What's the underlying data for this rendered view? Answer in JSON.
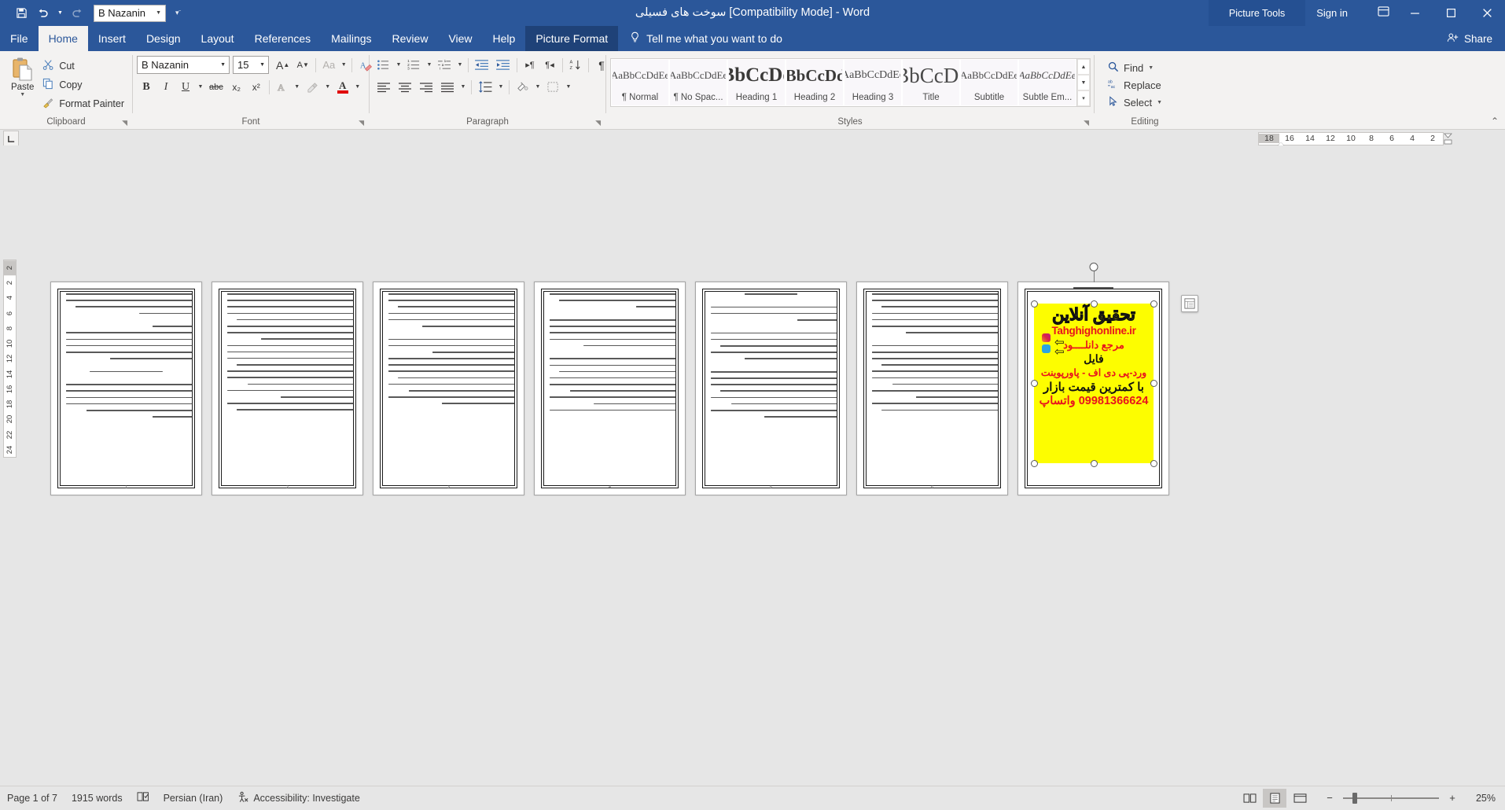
{
  "titlebar": {
    "save_icon": "save-icon",
    "undo_icon": "undo-icon",
    "redo_icon": "redo-icon",
    "font_quick": "B Nazanin",
    "qat_more": "qat-more-icon",
    "doc_title_rtl": "سوخت های فسیلی",
    "doc_title_mode": "[Compatibility Mode]",
    "doc_app": "Word",
    "separator": "-",
    "picture_tools": "Picture Tools",
    "signin": "Sign in",
    "ribbon_display_icon": "ribbon-display-options-icon",
    "minimize": "minimize-icon",
    "restore": "restore-icon",
    "close": "close-icon"
  },
  "tabs": [
    {
      "label": "File",
      "active": false
    },
    {
      "label": "Home",
      "active": true
    },
    {
      "label": "Insert",
      "active": false
    },
    {
      "label": "Design",
      "active": false
    },
    {
      "label": "Layout",
      "active": false
    },
    {
      "label": "References",
      "active": false
    },
    {
      "label": "Mailings",
      "active": false
    },
    {
      "label": "Review",
      "active": false
    },
    {
      "label": "View",
      "active": false
    },
    {
      "label": "Help",
      "active": false
    },
    {
      "label": "Picture Format",
      "active": false
    }
  ],
  "tellme": {
    "icon": "lightbulb-icon",
    "placeholder": "Tell me what you want to do"
  },
  "share": {
    "label": "Share",
    "icon": "share-person-icon"
  },
  "clipboard": {
    "group_label": "Clipboard",
    "paste": "Paste",
    "cut": "Cut",
    "copy": "Copy",
    "format_painter": "Format Painter"
  },
  "font": {
    "group_label": "Font",
    "name": "B Nazanin",
    "size": "15",
    "grow": "A",
    "shrink": "A",
    "change_case": "Aa",
    "clear_formatting": "clear-formatting-icon",
    "bold": "B",
    "italic": "I",
    "underline": "U",
    "strikethrough": "abc",
    "subscript": "x₂",
    "superscript": "x²",
    "text_effects": "A",
    "highlight": "highlight-icon",
    "font_color": "A"
  },
  "paragraph": {
    "group_label": "Paragraph",
    "bullets": "bullets-icon",
    "numbering": "numbering-icon",
    "multilevel": "multilevel-list-icon",
    "decrease_indent": "decrease-indent-icon",
    "increase_indent": "increase-indent-icon",
    "ltr": "left-to-right-icon",
    "rtl": "right-to-left-icon",
    "sort": "sort-icon",
    "show_marks": "show-formatting-marks-icon",
    "align_left": "align-left-icon",
    "align_center": "align-center-icon",
    "align_right": "align-right-icon",
    "justify": "justify-icon",
    "line_spacing": "line-spacing-icon",
    "shading": "shading-icon",
    "borders": "borders-icon"
  },
  "styles": {
    "group_label": "Styles",
    "items": [
      {
        "preview": "AaBbCcDdEe",
        "name": "¶ Normal",
        "size": 13,
        "bold": false,
        "italic": false
      },
      {
        "preview": "AaBbCcDdEe",
        "name": "¶ No Spac...",
        "size": 13,
        "bold": false,
        "italic": false
      },
      {
        "preview": "AaBbCcDdEe",
        "name": "Heading 1",
        "size": 25,
        "bold": true,
        "italic": false
      },
      {
        "preview": "AaBbCcDdEe",
        "name": "Heading 2",
        "size": 21,
        "bold": true,
        "italic": false
      },
      {
        "preview": "AaBbCcDdEe",
        "name": "Heading 3",
        "size": 14,
        "bold": false,
        "italic": false
      },
      {
        "preview": "AaBbCcDdEe",
        "name": "Title",
        "size": 27,
        "bold": false,
        "italic": false
      },
      {
        "preview": "AaBbCcDdEe",
        "name": "Subtitle",
        "size": 13,
        "bold": false,
        "italic": false
      },
      {
        "preview": "AaBbCcDdEe",
        "name": "Subtle Em...",
        "size": 13,
        "bold": false,
        "italic": true
      }
    ]
  },
  "editing": {
    "group_label": "Editing",
    "find": "Find",
    "replace": "Replace",
    "select": "Select"
  },
  "ruler": {
    "tab_selector_icon": "tab-stop-left-icon",
    "h_marks": [
      "18",
      "16",
      "14",
      "12",
      "10",
      "8",
      "6",
      "4",
      "2"
    ],
    "v_marks": [
      "2",
      "2",
      "4",
      "6",
      "8",
      "10",
      "12",
      "14",
      "16",
      "18",
      "20",
      "22",
      "24"
    ]
  },
  "document": {
    "page_count": 7,
    "pages": [
      {
        "num": "1",
        "has_image": false
      },
      {
        "num": "2",
        "has_image": false
      },
      {
        "num": "3",
        "has_image": false
      },
      {
        "num": "4",
        "has_image": false
      },
      {
        "num": "5",
        "has_image": false
      },
      {
        "num": "6",
        "has_image": false
      },
      {
        "num": "7",
        "has_image": true
      }
    ],
    "selected_image": {
      "name": "advertisement-image",
      "bg_color": "#fdfd00",
      "line1": "تحقیق آنلاین",
      "line2_url": "Tahghighonline.ir",
      "line3": "مرجع دانلــــود",
      "line4": "فایل",
      "line5": "ورد-پی دی اف - پاورپوینت",
      "line6": "با کمترین قیمت بازار",
      "line7": "09981366624 واتساپ",
      "red_color": "#e8131d",
      "layout_options_icon": "layout-options-icon"
    }
  },
  "statusbar": {
    "page": "Page 1 of 7",
    "words": "1915 words",
    "proofing_icon": "proofing-icon",
    "language": "Persian (Iran)",
    "accessibility_icon": "accessibility-icon",
    "accessibility": "Accessibility: Investigate",
    "view_read": "read-mode-icon",
    "view_print": "print-layout-icon",
    "view_web": "web-layout-icon",
    "zoom_out": "−",
    "zoom_in": "+",
    "zoom_level": "25%"
  }
}
